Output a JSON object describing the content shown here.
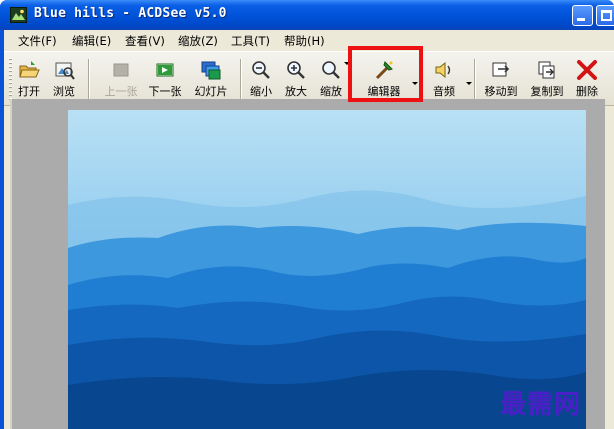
{
  "window": {
    "title": "Blue hills - ACDSee v5.0"
  },
  "menu": [
    {
      "label": "文件(F)"
    },
    {
      "label": "编辑(E)"
    },
    {
      "label": "查看(V)"
    },
    {
      "label": "缩放(Z)"
    },
    {
      "label": "工具(T)"
    },
    {
      "label": "帮助(H)"
    }
  ],
  "toolbar": {
    "buttons": [
      {
        "label": "打开",
        "icon": "open-folder-icon",
        "disabled": false
      },
      {
        "label": "浏览",
        "icon": "browse-icon",
        "disabled": false
      },
      {
        "label": "上一张",
        "icon": "previous-image-icon",
        "disabled": true
      },
      {
        "label": "下一张",
        "icon": "next-image-icon",
        "disabled": false
      },
      {
        "label": "幻灯片",
        "icon": "slideshow-icon",
        "disabled": false
      },
      {
        "label": "缩小",
        "icon": "zoom-out-icon",
        "disabled": false
      },
      {
        "label": "放大",
        "icon": "zoom-in-icon",
        "disabled": false
      },
      {
        "label": "缩放",
        "icon": "zoom-icon",
        "disabled": false,
        "dropdown": true
      },
      {
        "label": "编辑器",
        "icon": "editor-wand-icon",
        "disabled": false,
        "dropdown": true,
        "highlighted": true
      },
      {
        "label": "音频",
        "icon": "speaker-icon",
        "disabled": false,
        "dropdown": true
      },
      {
        "label": "移动到",
        "icon": "move-to-icon",
        "disabled": false
      },
      {
        "label": "复制到",
        "icon": "copy-to-icon",
        "disabled": false
      },
      {
        "label": "删除",
        "icon": "delete-icon",
        "disabled": false
      }
    ]
  },
  "image": {
    "description_visible": false
  },
  "watermark": {
    "text": "最需网"
  },
  "colors": {
    "titlebar": "#0052d8",
    "highlight": "#ee1111",
    "watermark": "#4b1fc8",
    "viewer_background": "#ababab"
  }
}
